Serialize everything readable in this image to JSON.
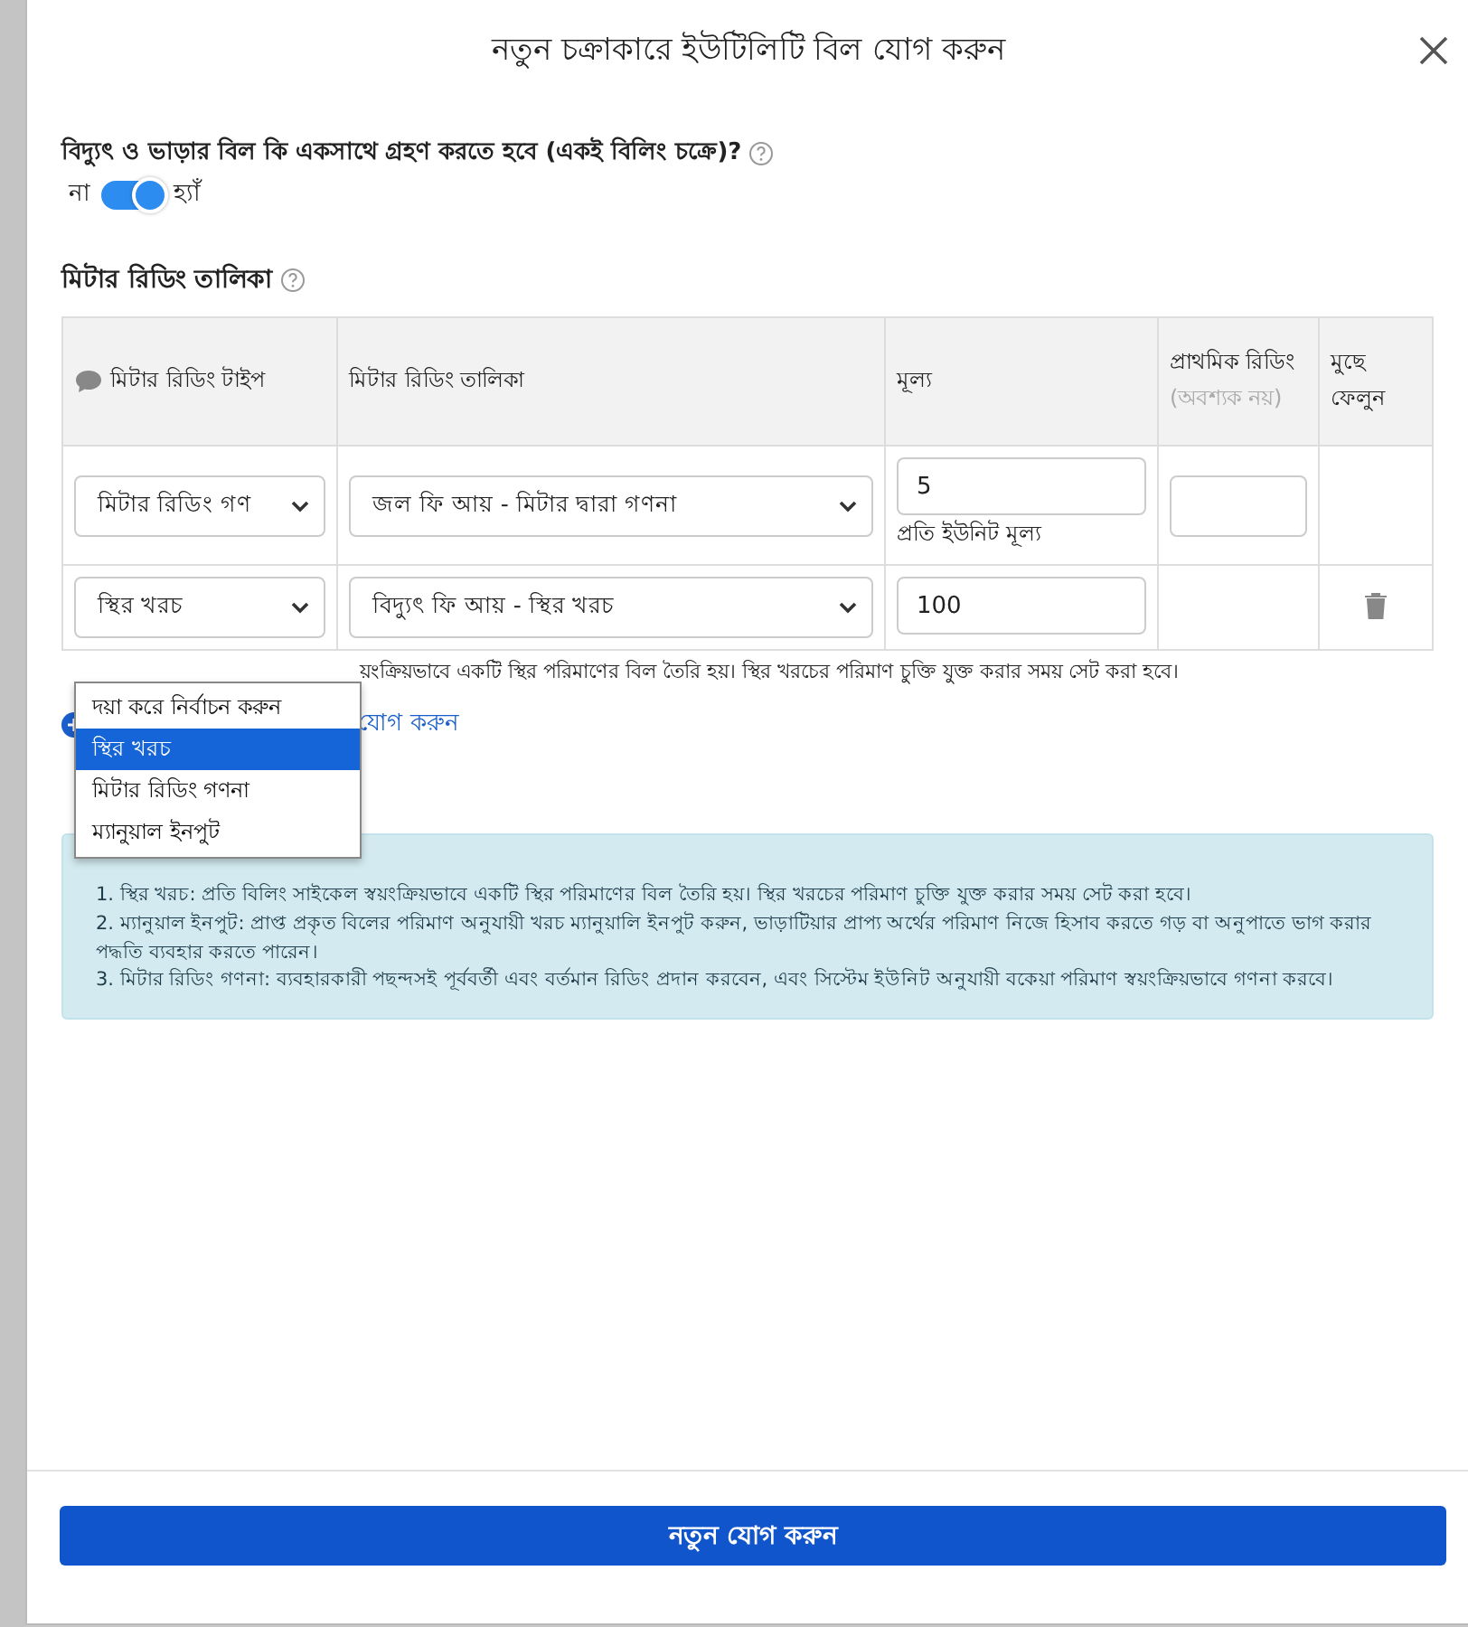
{
  "modal": {
    "title": "নতুন চক্রাকারে ইউটিলিটি বিল যোগ করুন"
  },
  "question": {
    "label": "বিদ্যুৎ ও ভাড়ার বিল কি একসাথে গ্রহণ করতে হবে (একই বিলিং চক্রে)?"
  },
  "toggle": {
    "off_label": "না",
    "on_label": "হ্যাঁ",
    "on": true
  },
  "section_title": "মিটার রিডিং তালিকা",
  "table": {
    "columns": [
      {
        "label": "মিটার রিডিং টাইপ"
      },
      {
        "label": "মিটার রিডিং তালিকা"
      },
      {
        "label": "মূল্য"
      },
      {
        "label": "প্রাথমিক রিডিং",
        "note": "(অবশ্যক নয়)"
      },
      {
        "label": "মুছে ফেলুন"
      }
    ],
    "rows": [
      {
        "type": "মিটার রিডিং গণ",
        "list": "জল ফি আয় - মিটার দ্বারা গণনা",
        "price": "5",
        "price_note": "প্রতি ইউনিট মূল্য",
        "initial_reading_field": true,
        "deletable": false
      },
      {
        "type": "স্থির খরচ",
        "list": "বিদ্যুৎ ফি আয় - স্থির খরচ",
        "price": "100",
        "initial_reading_field": false,
        "deletable": true
      }
    ]
  },
  "type_dropdown": {
    "open": true,
    "options": [
      {
        "label": "দয়া করে নির্বাচন করুন",
        "selected": false
      },
      {
        "label": "স্থির খরচ",
        "selected": true
      },
      {
        "label": "মিটার রিডিং গণনা",
        "selected": false
      },
      {
        "label": "ম্যানুয়াল ইনপুট",
        "selected": false
      }
    ]
  },
  "hint": "য়ংক্রিয়ভাবে একটি স্থির পরিমাণের বিল তৈরি হয়। স্থির খরচের পরিমাণ চুক্তি যুক্ত করার সময় সেট করা হবে।",
  "add_link": "যোগ করুন",
  "info": [
    "1. স্থির খরচ: প্রতি বিলিং সাইকেল স্বয়ংক্রিয়ভাবে একটি স্থির পরিমাণের বিল তৈরি হয়। স্থির খরচের পরিমাণ চুক্তি যুক্ত করার সময় সেট করা হবে।",
    "2. ম্যানুয়াল ইনপুট: প্রাপ্ত প্রকৃত বিলের পরিমাণ অনুযায়ী খরচ ম্যানুয়ালি ইনপুট করুন, ভাড়াটিয়ার প্রাপ্য অর্থের পরিমাণ নিজে হিসাব করতে গড় বা অনুপাতে ভাগ করার পদ্ধতি ব্যবহার করতে পারেন।",
    "3. মিটার রিডিং গণনা: ব্যবহারকারী পছন্দসই পূর্ববর্তী এবং বর্তমান রিডিং প্রদান করবেন, এবং সিস্টেম ইউনিট অনুযায়ী বকেয়া পরিমাণ স্বয়ংক্রিয়ভাবে গণনা করবে।"
  ],
  "submit": "নতুন যোগ করুন"
}
